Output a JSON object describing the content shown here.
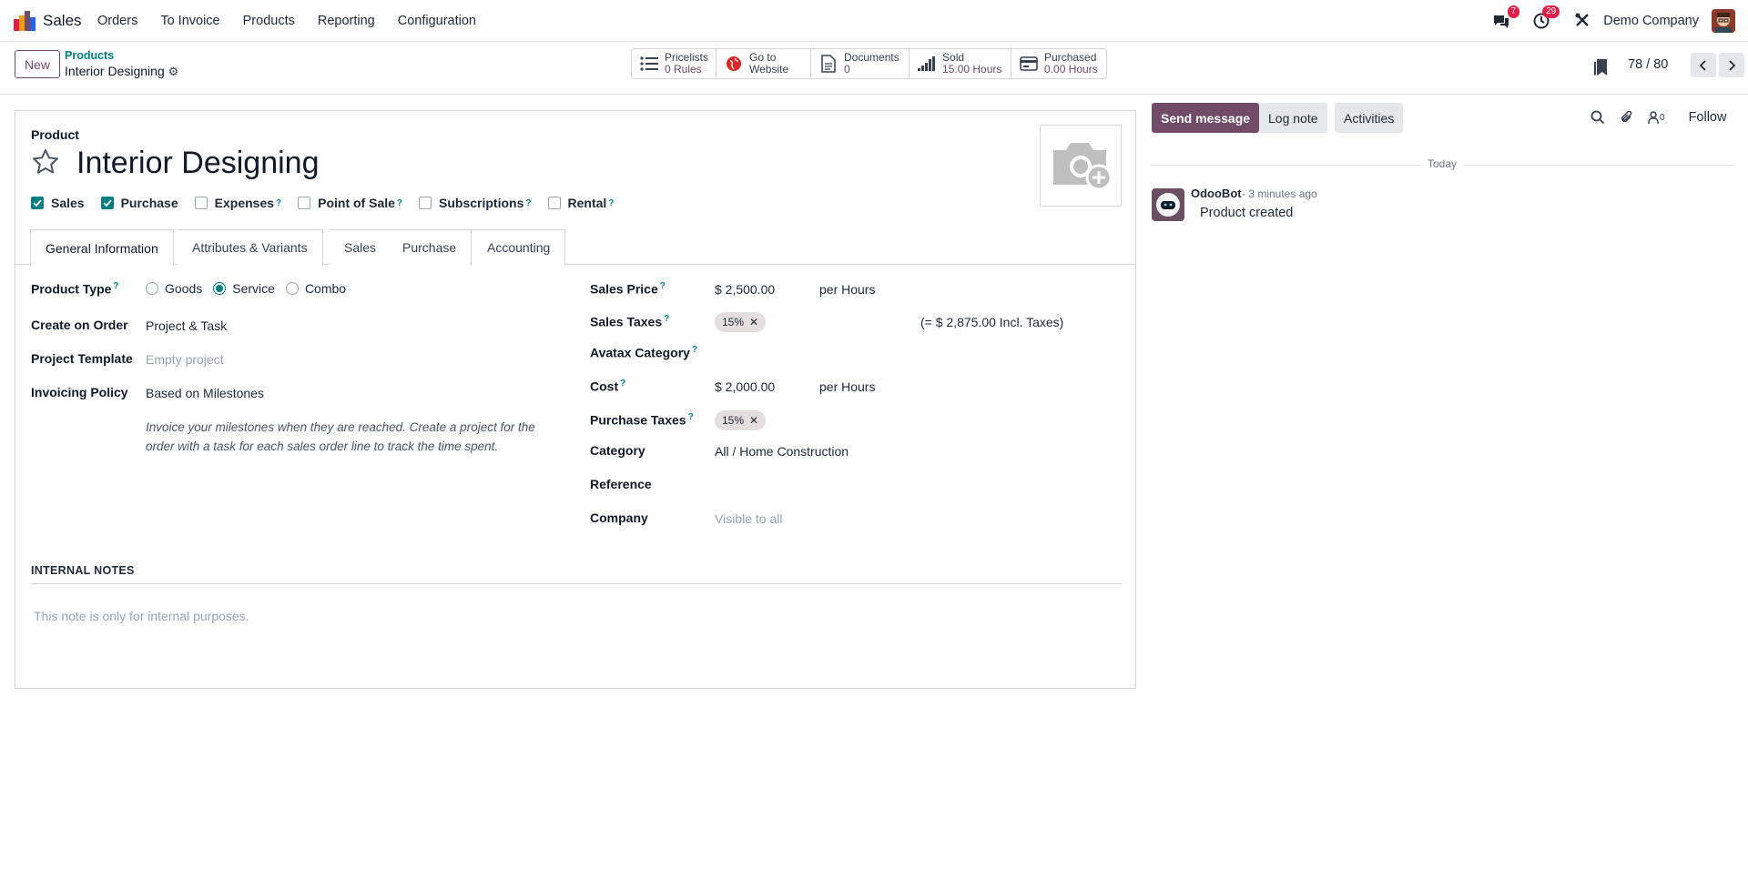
{
  "app": {
    "name": "Sales",
    "logo": "odoo-sales-logo"
  },
  "nav": {
    "menu": [
      "Orders",
      "To Invoice",
      "Products",
      "Reporting",
      "Configuration"
    ],
    "messages_badge": "7",
    "activities_badge": "29",
    "company": "Demo Company"
  },
  "control": {
    "new_label": "New",
    "breadcrumb_parent": "Products",
    "breadcrumb_current": "Interior Designing",
    "smart_buttons": [
      {
        "label": "Pricelists",
        "value": "0 Rules",
        "icon": "list-icon"
      },
      {
        "label": "Go to",
        "value": "Website",
        "icon": "globe-icon"
      },
      {
        "label": "Documents",
        "value": "0",
        "icon": "document-icon"
      },
      {
        "label": "Sold",
        "value": "15.00 Hours",
        "icon": "signal-icon"
      },
      {
        "label": "Purchased",
        "value": "0.00 Hours",
        "icon": "credit-card-icon"
      }
    ],
    "pager": "78 / 80"
  },
  "form": {
    "product_label": "Product",
    "product_name": "Interior Designing",
    "checkboxes": [
      {
        "label": "Sales",
        "checked": true,
        "help": false
      },
      {
        "label": "Purchase",
        "checked": true,
        "help": false
      },
      {
        "label": "Expenses",
        "checked": false,
        "help": true
      },
      {
        "label": "Point of Sale",
        "checked": false,
        "help": true
      },
      {
        "label": "Subscriptions",
        "checked": false,
        "help": true
      },
      {
        "label": "Rental",
        "checked": false,
        "help": true
      }
    ],
    "tabs": [
      "General Information",
      "Attributes & Variants",
      "Sales",
      "Purchase",
      "Accounting"
    ],
    "active_tab": "General Information",
    "left": {
      "product_type_label": "Product Type",
      "product_type_options": [
        "Goods",
        "Service",
        "Combo"
      ],
      "product_type_selected": "Service",
      "create_on_order_label": "Create on Order",
      "create_on_order_value": "Project & Task",
      "project_template_label": "Project Template",
      "project_template_placeholder": "Empty project",
      "invoicing_policy_label": "Invoicing Policy",
      "invoicing_policy_value": "Based on Milestones",
      "invoicing_help": "Invoice your milestones when they are reached. Create a project for the order with a task for each sales order line to track the time spent."
    },
    "right": {
      "sales_price_label": "Sales Price",
      "sales_price_value": "$ 2,500.00",
      "sales_price_unit": "per Hours",
      "sales_taxes_label": "Sales Taxes",
      "sales_taxes_tag": "15%",
      "sales_taxes_incl": "(= $ 2,875.00 Incl. Taxes)",
      "avatax_label": "Avatax Category",
      "cost_label": "Cost",
      "cost_value": "$ 2,000.00",
      "cost_unit": "per Hours",
      "purchase_taxes_label": "Purchase Taxes",
      "purchase_taxes_tag": "15%",
      "category_label": "Category",
      "category_value": "All / Home Construction",
      "reference_label": "Reference",
      "company_label": "Company",
      "company_placeholder": "Visible to all"
    },
    "internal_notes_title": "INTERNAL NOTES",
    "internal_notes_placeholder": "This note is only for internal purposes."
  },
  "chatter": {
    "send_message": "Send message",
    "log_note": "Log note",
    "activities": "Activities",
    "followers_count": "0",
    "follow": "Follow",
    "today": "Today",
    "messages": [
      {
        "author": "OdooBot",
        "time": "- 3 minutes ago",
        "body": "Product created"
      }
    ]
  },
  "colors": {
    "brand": "#714b67",
    "accent": "#017e84",
    "badge": "#e11d48"
  }
}
